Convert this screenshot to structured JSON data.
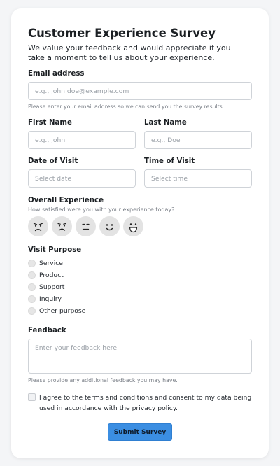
{
  "form": {
    "title": "Customer Experience Survey",
    "intro": "We value your feedback and would appreciate if you take a moment to tell us about your experience."
  },
  "email": {
    "label": "Email address",
    "placeholder": "e.g., john.doe@example.com",
    "hint": "Please enter your email address so we can send you the survey results."
  },
  "first_name": {
    "label": "First Name",
    "placeholder": "e.g., John"
  },
  "last_name": {
    "label": "Last Name",
    "placeholder": "e.g., Doe"
  },
  "date_of_visit": {
    "label": "Date of Visit",
    "placeholder": "Select date"
  },
  "time_of_visit": {
    "label": "Time of Visit",
    "placeholder": "Select time"
  },
  "experience": {
    "label": "Overall Experience",
    "question": "How satisfied were you with your experience today?",
    "ratings": [
      "angry-face-icon",
      "frowning-face-icon",
      "neutral-face-icon",
      "smiling-face-icon",
      "grinning-face-icon"
    ]
  },
  "visit_purpose": {
    "label": "Visit Purpose",
    "options": [
      "Service",
      "Product",
      "Support",
      "Inquiry",
      "Other purpose"
    ]
  },
  "feedback": {
    "label": "Feedback",
    "placeholder": "Enter your feedback here",
    "hint": "Please provide any additional feedback you may have."
  },
  "consent": {
    "text": "I agree to the terms and conditions and consent to my data being used in accordance with the privacy policy."
  },
  "submit_label": "Submit Survey",
  "colors": {
    "accent": "#3b8ee2",
    "emoji_background": "#e3e3e3",
    "border": "#cfd3d8"
  }
}
